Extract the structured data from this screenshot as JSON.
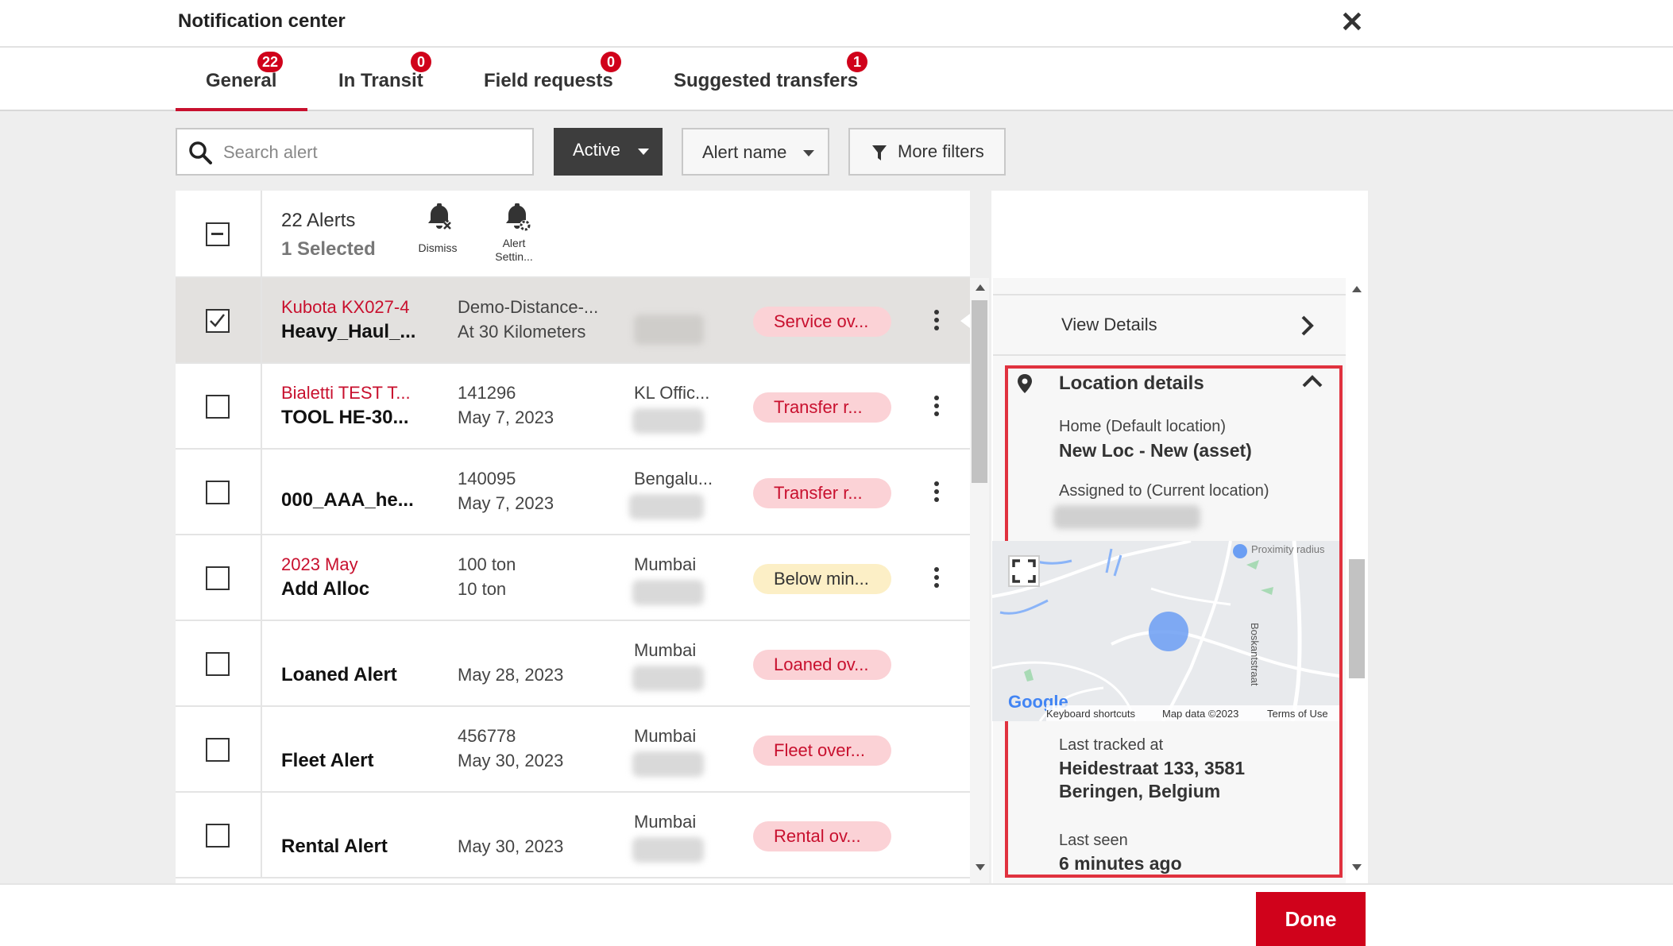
{
  "header": {
    "title": "Notification center"
  },
  "tabs": [
    {
      "label": "General",
      "badge": "22"
    },
    {
      "label": "In Transit",
      "badge": "0"
    },
    {
      "label": "Field requests",
      "badge": "0"
    },
    {
      "label": "Suggested transfers",
      "badge": "1"
    }
  ],
  "filters": {
    "search_placeholder": "Search alert",
    "status": "Active",
    "alert_name": "Alert name",
    "more_filters": "More filters"
  },
  "list_header": {
    "count": "22 Alerts",
    "selected": "1 Selected",
    "dismiss_label": "Dismiss",
    "alert_settings_label_1": "Alert",
    "alert_settings_label_2": "Settin..."
  },
  "rows": [
    {
      "name1": "Kubota KX027-4",
      "name2": "Heavy_Haul_...",
      "c2a": "Demo-Distance-...",
      "c2b": "At 30 Kilometers",
      "c3a": "",
      "pill": "Service ov...",
      "checked": true
    },
    {
      "name1": "Bialetti TEST T...",
      "name2": "TOOL HE-30...",
      "c2a": "141296",
      "c2b": "May 7, 2023",
      "c3a": "KL Offic...",
      "pill": "Transfer r...",
      "checked": false
    },
    {
      "name1": "",
      "name2": "000_AAA_he...",
      "c2a": "140095",
      "c2b": "May 7, 2023",
      "c3a": "Bengalu...",
      "pill": "Transfer r...",
      "checked": false
    },
    {
      "name1": "2023 May",
      "name2": "Add Alloc",
      "c2a": "100 ton",
      "c2b": "10 ton",
      "c3a": "Mumbai",
      "pill": "Below min...",
      "checked": false
    },
    {
      "name1": "",
      "name2": "Loaned Alert",
      "c2a": "",
      "c2b": "May 28, 2023",
      "c3a": "Mumbai",
      "pill": "Loaned ov...",
      "checked": false
    },
    {
      "name1": "",
      "name2": "Fleet Alert",
      "c2a": "456778",
      "c2b": "May 30, 2023",
      "c3a": "Mumbai",
      "pill": "Fleet over...",
      "checked": false
    },
    {
      "name1": "",
      "name2": "Rental Alert",
      "c2a": "",
      "c2b": "May 30, 2023",
      "c3a": "Mumbai",
      "pill": "Rental ov...",
      "checked": false
    }
  ],
  "details": {
    "view_details": "View Details",
    "location_title": "Location details",
    "home_label": "Home (Default location)",
    "home_value": "New Loc - New (asset)",
    "assigned_label": "Assigned to (Current location)",
    "map": {
      "proximity": "Proximity radius",
      "street": "Boskantstraat",
      "shortcuts": "Keyboard shortcuts",
      "map_data": "Map data ©2023",
      "terms": "Terms of Use",
      "logo": "Google"
    },
    "last_tracked_label": "Last tracked at",
    "last_tracked_line1": "Heidestraat 133, 3581",
    "last_tracked_line2": "Beringen, Belgium",
    "last_seen_label": "Last seen",
    "last_seen_value": "6 minutes ago"
  },
  "footer": {
    "done": "Done"
  },
  "colors": {
    "accent": "#c8102e",
    "badge": "#d0021b",
    "highlight_border": "#e0323f",
    "dark_button": "#3d3d3d"
  }
}
